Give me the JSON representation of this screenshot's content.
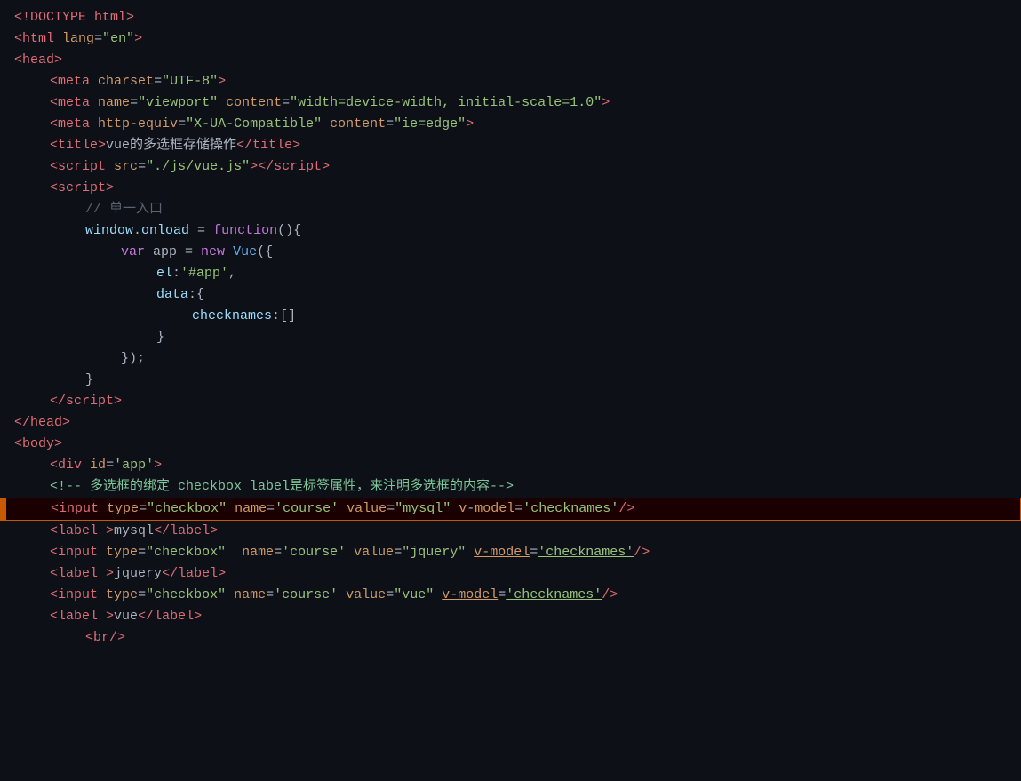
{
  "lines": [
    {
      "id": 1,
      "tokens": [
        {
          "text": "<!DOCTYPE html>",
          "class": "tag"
        }
      ]
    },
    {
      "id": 2,
      "tokens": [
        {
          "text": "<",
          "class": "tag"
        },
        {
          "text": "html",
          "class": "tag"
        },
        {
          "text": " ",
          "class": "plain"
        },
        {
          "text": "lang",
          "class": "attr-name"
        },
        {
          "text": "=",
          "class": "plain"
        },
        {
          "text": "\"en\"",
          "class": "attr-value"
        },
        {
          "text": ">",
          "class": "tag"
        }
      ]
    },
    {
      "id": 3,
      "tokens": [
        {
          "text": "<",
          "class": "tag"
        },
        {
          "text": "head",
          "class": "tag"
        },
        {
          "text": ">",
          "class": "tag"
        }
      ]
    },
    {
      "id": 4,
      "indent": 1,
      "tokens": [
        {
          "text": "<",
          "class": "tag"
        },
        {
          "text": "meta",
          "class": "tag"
        },
        {
          "text": " ",
          "class": "plain"
        },
        {
          "text": "charset",
          "class": "attr-name"
        },
        {
          "text": "=",
          "class": "plain"
        },
        {
          "text": "\"UTF-8\"",
          "class": "attr-value"
        },
        {
          "text": ">",
          "class": "tag"
        }
      ]
    },
    {
      "id": 5,
      "indent": 1,
      "tokens": [
        {
          "text": "<",
          "class": "tag"
        },
        {
          "text": "meta",
          "class": "tag"
        },
        {
          "text": " ",
          "class": "plain"
        },
        {
          "text": "name",
          "class": "attr-name"
        },
        {
          "text": "=",
          "class": "plain"
        },
        {
          "text": "\"viewport\"",
          "class": "attr-value"
        },
        {
          "text": " ",
          "class": "plain"
        },
        {
          "text": "content",
          "class": "attr-name"
        },
        {
          "text": "=",
          "class": "plain"
        },
        {
          "text": "\"width=device-width, initial-scale=1.0\"",
          "class": "attr-value"
        },
        {
          "text": ">",
          "class": "tag"
        }
      ]
    },
    {
      "id": 6,
      "indent": 1,
      "tokens": [
        {
          "text": "<",
          "class": "tag"
        },
        {
          "text": "meta",
          "class": "tag"
        },
        {
          "text": " ",
          "class": "plain"
        },
        {
          "text": "http-equiv",
          "class": "attr-name"
        },
        {
          "text": "=",
          "class": "plain"
        },
        {
          "text": "\"X-UA-Compatible\"",
          "class": "attr-value"
        },
        {
          "text": " ",
          "class": "plain"
        },
        {
          "text": "content",
          "class": "attr-name"
        },
        {
          "text": "=",
          "class": "plain"
        },
        {
          "text": "\"ie=edge\"",
          "class": "attr-value"
        },
        {
          "text": ">",
          "class": "tag"
        }
      ]
    },
    {
      "id": 7,
      "indent": 1,
      "tokens": [
        {
          "text": "<",
          "class": "tag"
        },
        {
          "text": "title",
          "class": "tag"
        },
        {
          "text": ">",
          "class": "tag"
        },
        {
          "text": "vue的多选框存储操作",
          "class": "plain"
        },
        {
          "text": "</",
          "class": "tag"
        },
        {
          "text": "title",
          "class": "tag"
        },
        {
          "text": ">",
          "class": "tag"
        }
      ]
    },
    {
      "id": 8,
      "indent": 1,
      "tokens": [
        {
          "text": "<",
          "class": "tag"
        },
        {
          "text": "script",
          "class": "tag"
        },
        {
          "text": " ",
          "class": "plain"
        },
        {
          "text": "src",
          "class": "attr-name"
        },
        {
          "text": "=",
          "class": "plain"
        },
        {
          "text": "\"./js/vue.js\"",
          "class": "attr-value-underline"
        },
        {
          "text": ">",
          "class": "tag"
        },
        {
          "text": "</",
          "class": "tag"
        },
        {
          "text": "script",
          "class": "tag"
        },
        {
          "text": ">",
          "class": "tag"
        }
      ]
    },
    {
      "id": 9,
      "indent": 1,
      "tokens": [
        {
          "text": "<",
          "class": "tag"
        },
        {
          "text": "script",
          "class": "tag"
        },
        {
          "text": ">",
          "class": "tag"
        }
      ]
    },
    {
      "id": 10,
      "indent": 2,
      "tokens": [
        {
          "text": "// 单一入口",
          "class": "comment"
        }
      ]
    },
    {
      "id": 11,
      "indent": 2,
      "tokens": [
        {
          "text": "window",
          "class": "js-plain"
        },
        {
          "text": ".",
          "class": "plain"
        },
        {
          "text": "onload",
          "class": "js-plain"
        },
        {
          "text": " = ",
          "class": "plain"
        },
        {
          "text": "function",
          "class": "js-keyword"
        },
        {
          "text": "(){",
          "class": "plain"
        }
      ]
    },
    {
      "id": 12,
      "indent": 3,
      "tokens": [
        {
          "text": "var",
          "class": "js-keyword"
        },
        {
          "text": " app = ",
          "class": "plain"
        },
        {
          "text": "new",
          "class": "js-keyword"
        },
        {
          "text": " ",
          "class": "plain"
        },
        {
          "text": "Vue",
          "class": "blue"
        },
        {
          "text": "({",
          "class": "plain"
        }
      ]
    },
    {
      "id": 13,
      "indent": 4,
      "tokens": [
        {
          "text": "el",
          "class": "js-plain"
        },
        {
          "text": ":",
          "class": "plain"
        },
        {
          "text": "'#app'",
          "class": "js-string"
        },
        {
          "text": ",",
          "class": "plain"
        }
      ]
    },
    {
      "id": 14,
      "indent": 4,
      "tokens": [
        {
          "text": "data",
          "class": "js-plain"
        },
        {
          "text": ":{",
          "class": "plain"
        }
      ]
    },
    {
      "id": 15,
      "indent": 5,
      "tokens": [
        {
          "text": "checknames",
          "class": "js-plain"
        },
        {
          "text": ":[]",
          "class": "plain"
        }
      ]
    },
    {
      "id": 16,
      "indent": 4,
      "tokens": [
        {
          "text": "}",
          "class": "plain"
        }
      ]
    },
    {
      "id": 17,
      "indent": 3,
      "tokens": [
        {
          "text": "});",
          "class": "plain"
        }
      ]
    },
    {
      "id": 18,
      "indent": 2,
      "tokens": [
        {
          "text": "}",
          "class": "plain"
        }
      ]
    },
    {
      "id": 19,
      "tokens": []
    },
    {
      "id": 20,
      "indent": 1,
      "tokens": [
        {
          "text": "</",
          "class": "tag"
        },
        {
          "text": "script",
          "class": "tag"
        },
        {
          "text": ">",
          "class": "tag"
        }
      ]
    },
    {
      "id": 21,
      "tokens": [
        {
          "text": "</",
          "class": "tag"
        },
        {
          "text": "head",
          "class": "tag"
        },
        {
          "text": ">",
          "class": "tag"
        }
      ]
    },
    {
      "id": 22,
      "tokens": [
        {
          "text": "<",
          "class": "tag"
        },
        {
          "text": "body",
          "class": "tag"
        },
        {
          "text": ">",
          "class": "tag"
        }
      ]
    },
    {
      "id": 23,
      "indent": 1,
      "tokens": [
        {
          "text": "<",
          "class": "tag"
        },
        {
          "text": "div",
          "class": "tag"
        },
        {
          "text": " ",
          "class": "plain"
        },
        {
          "text": "id",
          "class": "attr-name"
        },
        {
          "text": "=",
          "class": "plain"
        },
        {
          "text": "'app'",
          "class": "attr-value"
        },
        {
          "text": ">",
          "class": "tag"
        }
      ]
    },
    {
      "id": 24,
      "indent": 1,
      "tokens": [
        {
          "text": "<!-- ",
          "class": "comment-green"
        },
        {
          "text": "多选框的绑定 checkbox label是标签属性，来注明多选框的内容",
          "class": "comment-green"
        },
        {
          "text": "-->",
          "class": "comment-green"
        }
      ]
    },
    {
      "id": 25,
      "indent": 1,
      "highlighted": true,
      "tokens": [
        {
          "text": "<",
          "class": "tag"
        },
        {
          "text": "input",
          "class": "tag"
        },
        {
          "text": " ",
          "class": "plain"
        },
        {
          "text": "type",
          "class": "attr-name"
        },
        {
          "text": "=",
          "class": "plain"
        },
        {
          "text": "\"checkbox\"",
          "class": "attr-value"
        },
        {
          "text": " ",
          "class": "plain"
        },
        {
          "text": "name",
          "class": "attr-name"
        },
        {
          "text": "=",
          "class": "plain"
        },
        {
          "text": "'course'",
          "class": "attr-value"
        },
        {
          "text": " ",
          "class": "plain"
        },
        {
          "text": "value",
          "class": "attr-name"
        },
        {
          "text": "=",
          "class": "plain"
        },
        {
          "text": "\"mysql\"",
          "class": "attr-value"
        },
        {
          "text": " ",
          "class": "plain"
        },
        {
          "text": "v",
          "class": "attr-name"
        },
        {
          "text": "-",
          "class": "plain"
        },
        {
          "text": "model",
          "class": "attr-name"
        },
        {
          "text": "=",
          "class": "plain"
        },
        {
          "text": "'checknames'",
          "class": "attr-value"
        },
        {
          "text": "/>",
          "class": "tag"
        }
      ]
    },
    {
      "id": 26,
      "indent": 1,
      "tokens": [
        {
          "text": "<",
          "class": "tag"
        },
        {
          "text": "label",
          "class": "tag"
        },
        {
          "text": " >",
          "class": "tag"
        },
        {
          "text": "mysql",
          "class": "plain"
        },
        {
          "text": "</",
          "class": "tag"
        },
        {
          "text": "label",
          "class": "tag"
        },
        {
          "text": ">",
          "class": "tag"
        }
      ]
    },
    {
      "id": 27,
      "indent": 1,
      "tokens": [
        {
          "text": "<",
          "class": "tag"
        },
        {
          "text": "input",
          "class": "tag"
        },
        {
          "text": " ",
          "class": "plain"
        },
        {
          "text": "type",
          "class": "attr-name"
        },
        {
          "text": "=",
          "class": "plain"
        },
        {
          "text": "\"checkbox\"",
          "class": "attr-value"
        },
        {
          "text": "  ",
          "class": "plain"
        },
        {
          "text": "name",
          "class": "attr-name"
        },
        {
          "text": "=",
          "class": "plain"
        },
        {
          "text": "'course'",
          "class": "attr-value"
        },
        {
          "text": " ",
          "class": "plain"
        },
        {
          "text": "value",
          "class": "attr-name"
        },
        {
          "text": "=",
          "class": "plain"
        },
        {
          "text": "\"jquery\"",
          "class": "attr-value"
        },
        {
          "text": " ",
          "class": "plain"
        },
        {
          "text": "v-model",
          "class": "attr-name-underline"
        },
        {
          "text": "=",
          "class": "plain"
        },
        {
          "text": "'checknames'",
          "class": "attr-value-underline2"
        },
        {
          "text": "/>",
          "class": "tag"
        }
      ]
    },
    {
      "id": 28,
      "indent": 1,
      "tokens": [
        {
          "text": "<",
          "class": "tag"
        },
        {
          "text": "label",
          "class": "tag"
        },
        {
          "text": " >",
          "class": "tag"
        },
        {
          "text": "jquery",
          "class": "plain"
        },
        {
          "text": "</",
          "class": "tag"
        },
        {
          "text": "label",
          "class": "tag"
        },
        {
          "text": ">",
          "class": "tag"
        }
      ]
    },
    {
      "id": 29,
      "indent": 1,
      "tokens": [
        {
          "text": "<",
          "class": "tag"
        },
        {
          "text": "input",
          "class": "tag"
        },
        {
          "text": " ",
          "class": "plain"
        },
        {
          "text": "type",
          "class": "attr-name"
        },
        {
          "text": "=",
          "class": "plain"
        },
        {
          "text": "\"checkbox\"",
          "class": "attr-value"
        },
        {
          "text": " ",
          "class": "plain"
        },
        {
          "text": "name",
          "class": "attr-name"
        },
        {
          "text": "=",
          "class": "plain"
        },
        {
          "text": "'course'",
          "class": "attr-value"
        },
        {
          "text": " ",
          "class": "plain"
        },
        {
          "text": "value",
          "class": "attr-name"
        },
        {
          "text": "=",
          "class": "plain"
        },
        {
          "text": "\"vue\"",
          "class": "attr-value"
        },
        {
          "text": " ",
          "class": "plain"
        },
        {
          "text": "v-model",
          "class": "attr-name-underline"
        },
        {
          "text": "=",
          "class": "plain"
        },
        {
          "text": "'checknames'",
          "class": "attr-value-underline2"
        },
        {
          "text": "/>",
          "class": "tag"
        }
      ]
    },
    {
      "id": 30,
      "indent": 1,
      "tokens": [
        {
          "text": "<",
          "class": "tag"
        },
        {
          "text": "label",
          "class": "tag"
        },
        {
          "text": " >",
          "class": "tag"
        },
        {
          "text": "vue",
          "class": "plain"
        },
        {
          "text": "</",
          "class": "tag"
        },
        {
          "text": "label",
          "class": "tag"
        },
        {
          "text": ">",
          "class": "tag"
        }
      ]
    },
    {
      "id": 31,
      "indent": 2,
      "tokens": [
        {
          "text": "<",
          "class": "tag"
        },
        {
          "text": "br",
          "class": "tag"
        },
        {
          "text": "/>",
          "class": "tag"
        }
      ]
    }
  ]
}
